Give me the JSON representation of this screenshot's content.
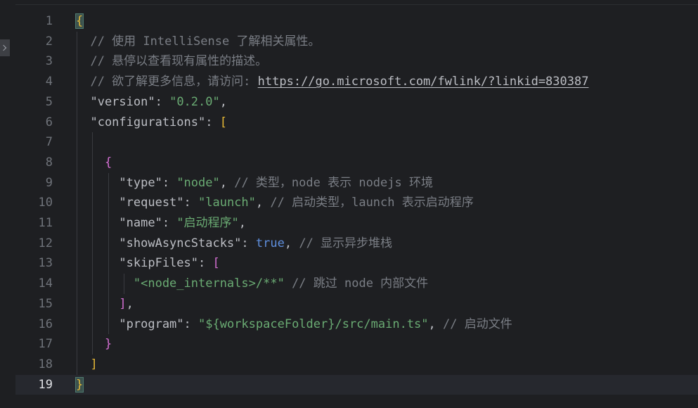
{
  "editor": {
    "lines": [
      {
        "num": "1",
        "tokens": [
          {
            "t": "{",
            "c": "y"
          }
        ]
      },
      {
        "num": "2",
        "tokens": [
          {
            "t": "  // 使用 IntelliSense 了解相关属性。",
            "c": "c"
          }
        ]
      },
      {
        "num": "3",
        "tokens": [
          {
            "t": "  // 悬停以查看现有属性的描述。",
            "c": "c"
          }
        ]
      },
      {
        "num": "4",
        "tokens": [
          {
            "t": "  // 欲了解更多信息，请访问: ",
            "c": "c"
          },
          {
            "t": "https://go.microsoft.com/fwlink/?linkid=830387",
            "c": "link"
          }
        ]
      },
      {
        "num": "5",
        "tokens": [
          {
            "t": "  \"version\"",
            "c": "pk"
          },
          {
            "t": ": ",
            "c": "p"
          },
          {
            "t": "\"0.2.0\"",
            "c": "s"
          },
          {
            "t": ",",
            "c": "p"
          }
        ]
      },
      {
        "num": "6",
        "tokens": [
          {
            "t": "  \"configurations\"",
            "c": "pk"
          },
          {
            "t": ": ",
            "c": "p"
          },
          {
            "t": "[",
            "c": "y"
          }
        ]
      },
      {
        "num": "7",
        "tokens": []
      },
      {
        "num": "8",
        "tokens": [
          {
            "t": "    {",
            "c": "m"
          }
        ]
      },
      {
        "num": "9",
        "tokens": [
          {
            "t": "      \"type\"",
            "c": "pk"
          },
          {
            "t": ": ",
            "c": "p"
          },
          {
            "t": "\"node\"",
            "c": "s"
          },
          {
            "t": ", ",
            "c": "p"
          },
          {
            "t": "// 类型，node 表示 nodejs 环境",
            "c": "c"
          }
        ]
      },
      {
        "num": "10",
        "tokens": [
          {
            "t": "      \"request\"",
            "c": "pk"
          },
          {
            "t": ": ",
            "c": "p"
          },
          {
            "t": "\"launch\"",
            "c": "s"
          },
          {
            "t": ", ",
            "c": "p"
          },
          {
            "t": "// 启动类型，launch 表示启动程序",
            "c": "c"
          }
        ]
      },
      {
        "num": "11",
        "tokens": [
          {
            "t": "      \"name\"",
            "c": "pk"
          },
          {
            "t": ": ",
            "c": "p"
          },
          {
            "t": "\"启动程序\"",
            "c": "s"
          },
          {
            "t": ",",
            "c": "p"
          }
        ]
      },
      {
        "num": "12",
        "tokens": [
          {
            "t": "      \"showAsyncStacks\"",
            "c": "pk"
          },
          {
            "t": ": ",
            "c": "p"
          },
          {
            "t": "true",
            "c": "kw"
          },
          {
            "t": ", ",
            "c": "p"
          },
          {
            "t": "// 显示异步堆栈",
            "c": "c"
          }
        ]
      },
      {
        "num": "13",
        "tokens": [
          {
            "t": "      \"skipFiles\"",
            "c": "pk"
          },
          {
            "t": ": ",
            "c": "p"
          },
          {
            "t": "[",
            "c": "m"
          }
        ]
      },
      {
        "num": "14",
        "tokens": [
          {
            "t": "        \"<node_internals>/**\"",
            "c": "s"
          },
          {
            "t": " ",
            "c": "p"
          },
          {
            "t": "// 跳过 node 内部文件",
            "c": "c"
          }
        ]
      },
      {
        "num": "15",
        "tokens": [
          {
            "t": "      ]",
            "c": "m"
          },
          {
            "t": ",",
            "c": "p"
          }
        ]
      },
      {
        "num": "16",
        "tokens": [
          {
            "t": "      \"program\"",
            "c": "pk"
          },
          {
            "t": ": ",
            "c": "p"
          },
          {
            "t": "\"${workspaceFolder}/src/main.ts\"",
            "c": "s"
          },
          {
            "t": ", ",
            "c": "p"
          },
          {
            "t": "// 启动文件",
            "c": "c"
          }
        ]
      },
      {
        "num": "17",
        "tokens": [
          {
            "t": "    }",
            "c": "m"
          }
        ]
      },
      {
        "num": "18",
        "tokens": [
          {
            "t": "  ]",
            "c": "y"
          }
        ]
      },
      {
        "num": "19",
        "tokens": [
          {
            "t": "}",
            "c": "y"
          }
        ],
        "current": true
      }
    ]
  },
  "colors": {
    "background": "#1e1f22",
    "current_line": "#26282e",
    "line_number": "#6f737a",
    "line_number_current": "#dfe1e5",
    "comment": "#7a7e85",
    "string": "#6aab73",
    "keyword": "#5f8fde",
    "bracket_level1": "#e8ba36",
    "bracket_level2": "#d46fd3",
    "default_text": "#bcbec4"
  }
}
